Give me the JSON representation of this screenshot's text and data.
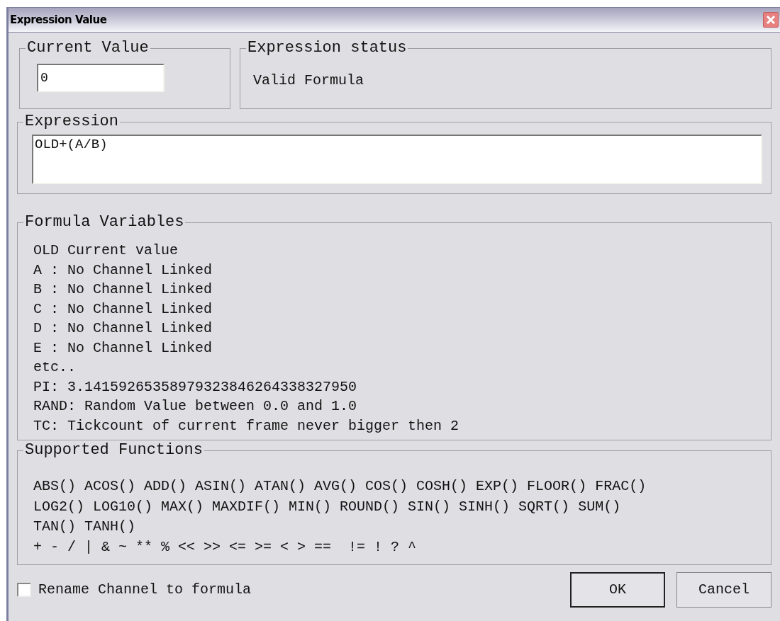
{
  "window": {
    "title": "Expression Value"
  },
  "current_value": {
    "label": "Current Value",
    "value": "0"
  },
  "status": {
    "label": "Expression status",
    "text": "Valid Formula"
  },
  "expression": {
    "label": "Expression",
    "value": "OLD+(A/B)"
  },
  "variables": {
    "label": "Formula Variables",
    "lines": [
      "OLD Current value",
      "A : No Channel Linked",
      "B : No Channel Linked",
      "C : No Channel Linked",
      "D : No Channel Linked",
      "E : No Channel Linked",
      "etc..",
      "PI: 3.14159265358979323846264338327950",
      "RAND: Random Value between 0.0 and 1.0",
      "TC: Tickcount of current frame never bigger then 2"
    ]
  },
  "functions": {
    "label": "Supported Functions",
    "lines": [
      "ABS() ACOS() ADD() ASIN() ATAN() AVG() COS() COSH() EXP() FLOOR() FRAC()",
      "LOG2() LOG10() MAX() MAXDIF() MIN() ROUND() SIN() SINH() SQRT() SUM()",
      "TAN() TANH()",
      "+ - / | & ~ ** % << >> <= >= < > ==  != ! ? ^"
    ]
  },
  "rename_checkbox": {
    "label": "Rename Channel to formula",
    "checked": false
  },
  "buttons": [
    "OK",
    "Cancel"
  ]
}
